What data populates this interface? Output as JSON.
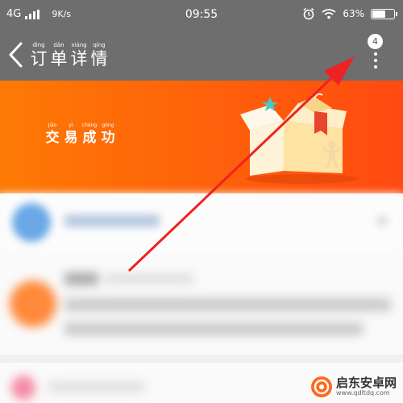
{
  "status_bar": {
    "network": "4G",
    "speed": "9K/s",
    "time": "09:55",
    "battery_percent": "63%",
    "battery_level": 0.63
  },
  "nav": {
    "title_chars": [
      {
        "pinyin": "dìng",
        "hanzi": "订"
      },
      {
        "pinyin": "dān",
        "hanzi": "单"
      },
      {
        "pinyin": "xiáng",
        "hanzi": "详"
      },
      {
        "pinyin": "qíng",
        "hanzi": "情"
      }
    ],
    "badge_count": "4"
  },
  "banner": {
    "status_chars": [
      {
        "pinyin": "jiāo",
        "hanzi": "交"
      },
      {
        "pinyin": "yì",
        "hanzi": "易"
      },
      {
        "pinyin": "chéng",
        "hanzi": "成"
      },
      {
        "pinyin": "gōng",
        "hanzi": "功"
      }
    ],
    "gradient_start": "#fe7a05",
    "gradient_end": "#ff4a10"
  },
  "watermark": {
    "name": "启东安卓网",
    "url": "www.qdltdq.com"
  },
  "colors": {
    "bar_gray": "#6e6e6e",
    "annotation_red": "#ee2222"
  }
}
